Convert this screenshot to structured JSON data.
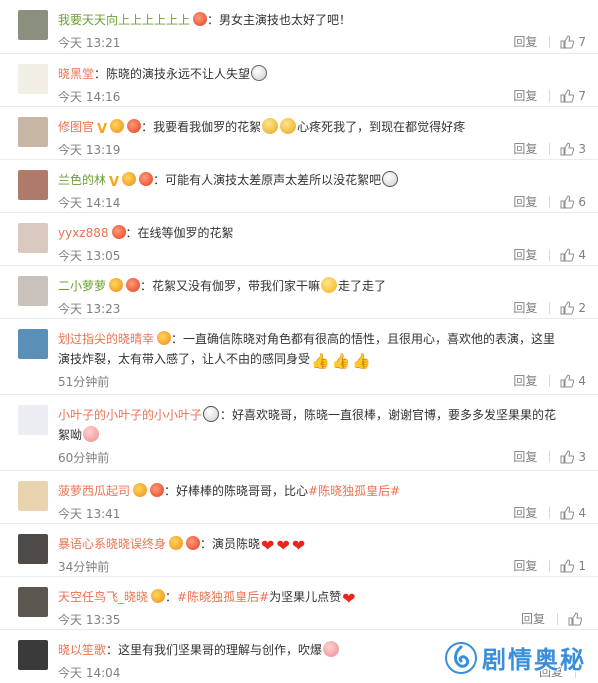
{
  "comments": [
    {
      "username": "我要天天向上上上上上上",
      "content": "男女主演技也太好了吧！",
      "time": "今天 13:21",
      "reply": "回复",
      "likes": "7",
      "avatar_color": "#8a8f7e"
    },
    {
      "username": "晓黑堂",
      "content": "陈晓的演技永远不让人失望",
      "time": "今天 14:16",
      "reply": "回复",
      "likes": "7",
      "avatar_color": "#f1eee4"
    },
    {
      "username": "修图官",
      "content": "我要看我伽罗的花絮",
      "content_2": "心疼死我了，到现在都觉得好疼",
      "time": "今天 13:19",
      "reply": "回复",
      "likes": "3",
      "avatar_color": "#c7b6a4"
    },
    {
      "username": "兰色的林",
      "content": "可能有人演技太差原声太差所以没花絮吧",
      "time": "今天 14:14",
      "reply": "回复",
      "likes": "6",
      "avatar_color": "#b07a6a"
    },
    {
      "username": "yyxz888",
      "content": "在线等伽罗的花絮",
      "time": "今天 13:05",
      "reply": "回复",
      "likes": "4",
      "avatar_color": "#d8c8c0"
    },
    {
      "username": "二小萝萝",
      "content": "花絮又没有伽罗，带我们家干嘛",
      "content_2": "走了走了",
      "time": "今天 13:23",
      "reply": "回复",
      "likes": "2",
      "avatar_color": "#c9c2bc"
    },
    {
      "username": "划过指尖的晓晴幸",
      "content": "一直确信陈晓对角色都有很高的悟性，且很用心，喜欢他的表演，这里演技炸裂，太有带入感了，让人不由的感同身受",
      "time": "51分钟前",
      "reply": "回复",
      "likes": "4",
      "avatar_color": "#5a8fb8"
    },
    {
      "username": "小叶子的小叶子的小小叶子",
      "content": "好喜欢晓哥，陈晓一直很棒，谢谢官博，要多多发坚果果的花絮呦",
      "time": "60分钟前",
      "reply": "回复",
      "likes": "3",
      "avatar_color": "#ecedf2"
    },
    {
      "username": "菠萝西瓜起司",
      "content": "好棒棒的陈晓哥哥，比心",
      "topic": "#陈晓独孤皇后#",
      "time": "今天 13:41",
      "reply": "回复",
      "likes": "4",
      "avatar_color": "#e9d2b0"
    },
    {
      "username": "暴语心系晓晓误终身",
      "content": "演员陈晓",
      "time": "34分钟前",
      "reply": "回复",
      "likes": "1",
      "avatar_color": "#4e4a48"
    },
    {
      "username": "天空任鸟飞_晓晓",
      "topic": "#陈晓独孤皇后#",
      "content": "为坚果儿点赞",
      "time": "今天 13:35",
      "reply": "回复",
      "likes": "",
      "avatar_color": "#5c5650"
    },
    {
      "username": "晓以笙歌",
      "content": "这里有我们坚果哥的理解与创作，吹爆",
      "time": "今天 14:04",
      "reply": "回复",
      "likes": "",
      "avatar_color": "#3a3a3a"
    }
  ],
  "watermark": {
    "text": "剧情奥秘"
  },
  "colors": {
    "username": "#eb7350",
    "username_green": "#6ba032",
    "meta": "#808080",
    "watermark": "#3a8fdc"
  }
}
